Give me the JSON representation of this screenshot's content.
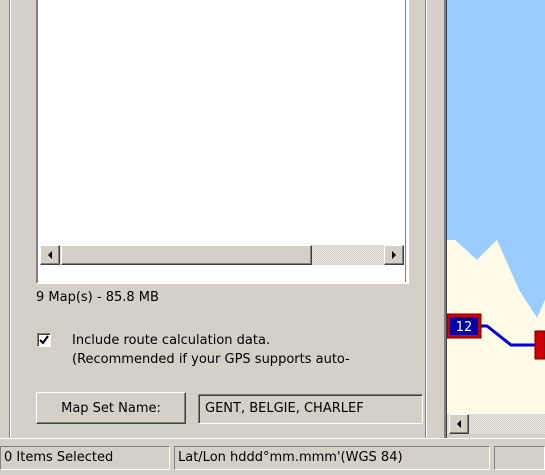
{
  "map_panel": {
    "scrollbar": {
      "left_arrow": "scroll-left-arrow-icon",
      "right_arrow": "scroll-right-arrow-icon"
    },
    "map_count_text": "9 Map(s) - 85.8 MB",
    "include_route": {
      "checked": true,
      "label": "Include route calculation data.",
      "note": "(Recommended if your GPS supports auto-"
    },
    "map_set_name": {
      "button_label": "Map Set Name:",
      "value": "GENT, BELGIE, CHARLEF"
    }
  },
  "map_view": {
    "route_marker_label": "12",
    "colors": {
      "water": "#99ccff",
      "land": "#fffbe6",
      "route": "#0000cc",
      "marker_fill": "#cc0000"
    },
    "scrollbar": {
      "left_arrow": "scroll-left-arrow-icon"
    }
  },
  "status_bar": {
    "selection": "0 Items Selected",
    "coordinate_format": "Lat/Lon hddd°mm.mmm'(WGS 84)",
    "extra": ""
  }
}
